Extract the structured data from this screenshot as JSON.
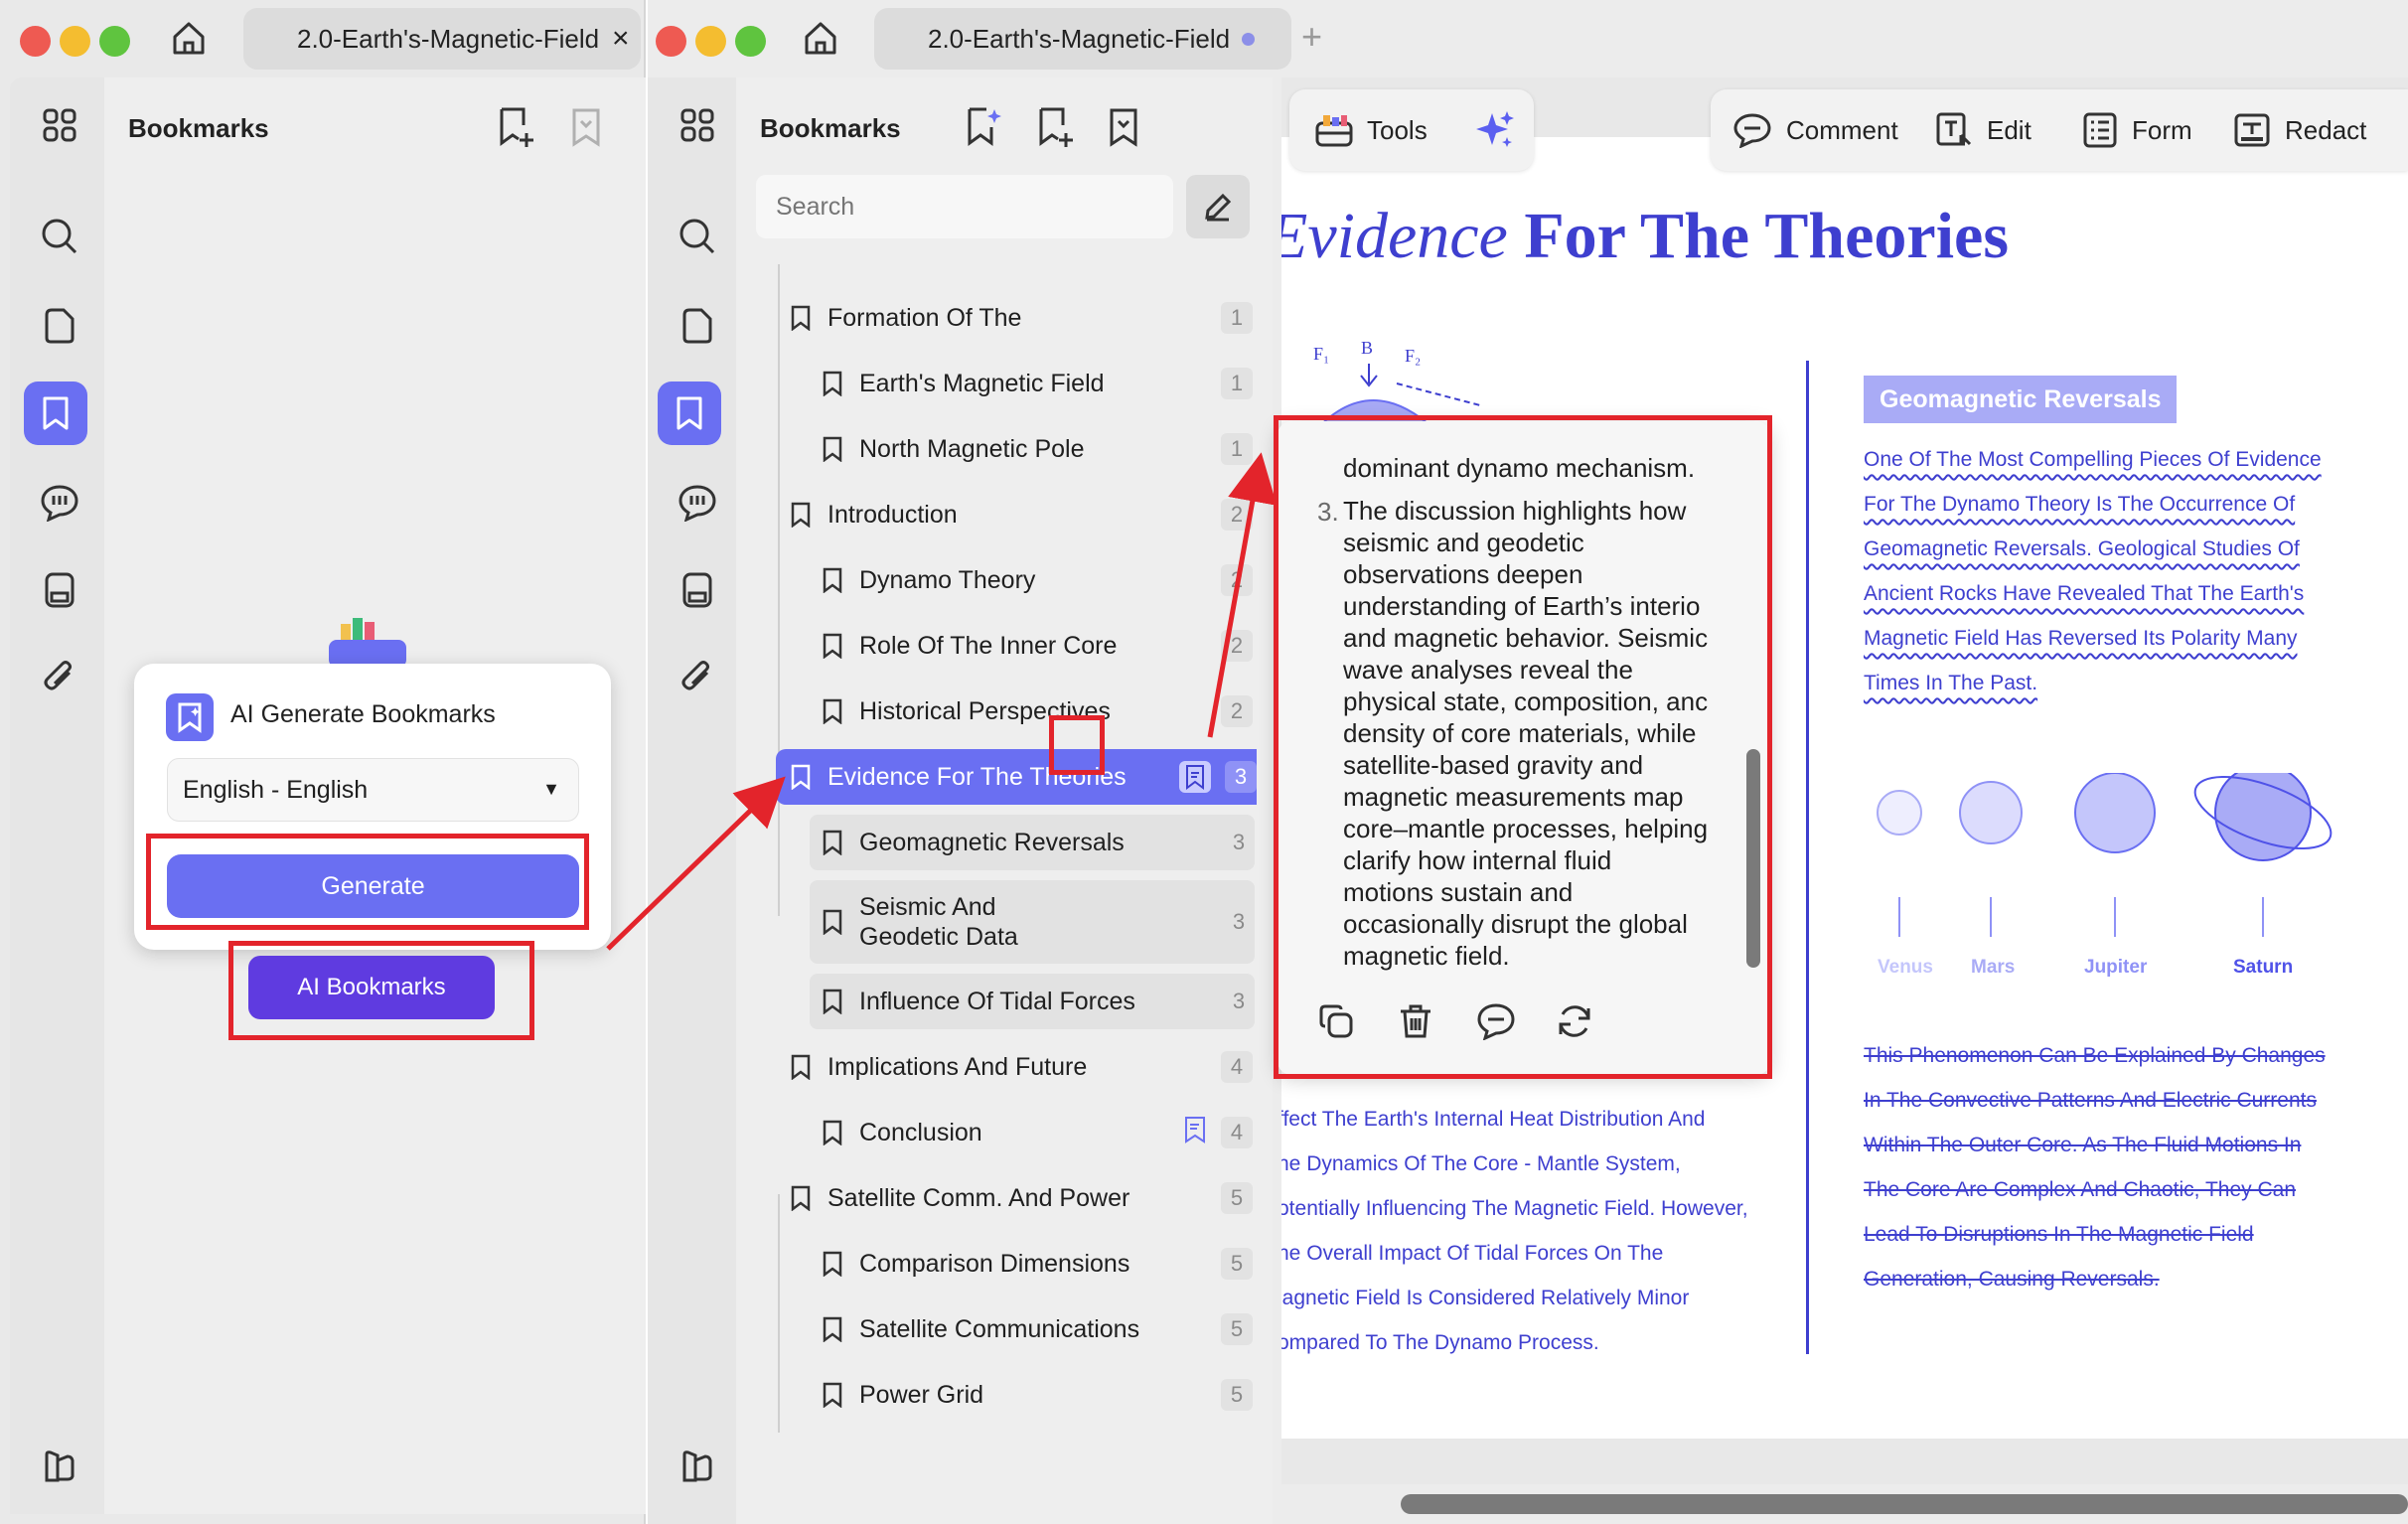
{
  "left_window": {
    "tab_title": "2.0-Earth's-Magnetic-Field",
    "tab_close": "×",
    "panel_title": "Bookmarks",
    "popup": {
      "title": "AI Generate Bookmarks",
      "language": "English - English",
      "generate_label": "Generate"
    },
    "ai_bookmarks_label": "AI Bookmarks"
  },
  "right_window": {
    "tab_title": "2.0-Earth's-Magnetic-Field",
    "new_tab": "+",
    "panel_title": "Bookmarks",
    "search_placeholder": "Search",
    "bookmarks": [
      {
        "label": "Formation Of The",
        "page": "1",
        "level": 0
      },
      {
        "label": "Earth's Magnetic Field",
        "page": "1",
        "level": 1
      },
      {
        "label": "North Magnetic Pole",
        "page": "1",
        "level": 1
      },
      {
        "label": "Introduction",
        "page": "2",
        "level": 0
      },
      {
        "label": "Dynamo Theory",
        "page": "2",
        "level": 1
      },
      {
        "label": "Role Of The Inner Core",
        "page": "2",
        "level": 1
      },
      {
        "label": "Historical Perspectives",
        "page": "2",
        "level": 1
      },
      {
        "label": "Evidence For The Theories",
        "page": "3",
        "level": 0,
        "selected": true
      },
      {
        "label": "Geomagnetic Reversals",
        "page": "3",
        "level": 1
      },
      {
        "label": "Seismic And Geodetic Data",
        "page": "3",
        "level": 1
      },
      {
        "label": "Influence Of Tidal Forces",
        "page": "3",
        "level": 1
      },
      {
        "label": "Implications And Future",
        "page": "4",
        "level": 0
      },
      {
        "label": "Conclusion",
        "page": "4",
        "level": 1
      },
      {
        "label": "Satellite Comm. And Power",
        "page": "5",
        "level": 0
      },
      {
        "label": "Comparison Dimensions",
        "page": "5",
        "level": 1
      },
      {
        "label": "Satellite Communications",
        "page": "5",
        "level": 1
      },
      {
        "label": "Power Grid",
        "page": "5",
        "level": 1
      }
    ],
    "seismic_line1": "Seismic And",
    "seismic_line2": "Geodetic Data"
  },
  "toolbar": {
    "tools": "Tools",
    "comment": "Comment",
    "edit": "Edit",
    "form": "Form",
    "redact": "Redact"
  },
  "summary_popup": {
    "lead": "dominant dynamo mechanism.",
    "number": "3.",
    "lines": [
      "The discussion highlights how",
      "seismic and geodetic",
      "observations deepen",
      "understanding of Earth’s interio",
      "and magnetic behavior. Seismic",
      "wave analyses reveal the",
      "physical state, composition, anc",
      "density of core materials, while",
      "satellite-based gravity and",
      "magnetic measurements map",
      "core–mantle processes, helping",
      "clarify how internal fluid",
      "motions sustain and",
      "occasionally disrupt the global",
      "magnetic field."
    ]
  },
  "document": {
    "heading_italic": "Evidence",
    "heading_bold": "For The Theories",
    "diagram_labels": {
      "f1": "F₁",
      "b": "B",
      "f2": "F₂"
    },
    "section_badge": "Geomagnetic Reversals",
    "reversal_lines": [
      "One Of The Most Compelling Pieces Of Evidence",
      "For The Dynamo Theory Is The Occurrence Of",
      "Geomagnetic Reversals. Geological Studies Of",
      "Ancient Rocks Have Revealed That The Earth's",
      "Magnetic Field Has Reversed Its Polarity Many",
      "Times In The Past."
    ],
    "planets": [
      "Venus",
      "Mars",
      "Jupiter",
      "Saturn"
    ],
    "phenomenon_lines": [
      "This Phenomenon Can Be Explained By Changes",
      "In The Convective Patterns And Electric Currents",
      "Within The Outer Core. As The Fluid Motions In",
      "The Core Are Complex And Chaotic, They Can",
      "Lead To Disruptions In The Magnetic Field",
      "Generation, Causing Reversals."
    ],
    "tidal_lines": [
      "ffect The Earth's Internal Heat Distribution And",
      "he Dynamics Of The Core - Mantle System,",
      "otentially Influencing The Magnetic Field. However,",
      "he Overall Impact Of Tidal Forces On The",
      "lagnetic Field Is Considered Relatively Minor",
      "ompared To The Dynamo Process."
    ]
  },
  "colors": {
    "accent": "#6a6ff2",
    "annotation_red": "#e3242b",
    "doc_blue": "#3e3fcf"
  }
}
